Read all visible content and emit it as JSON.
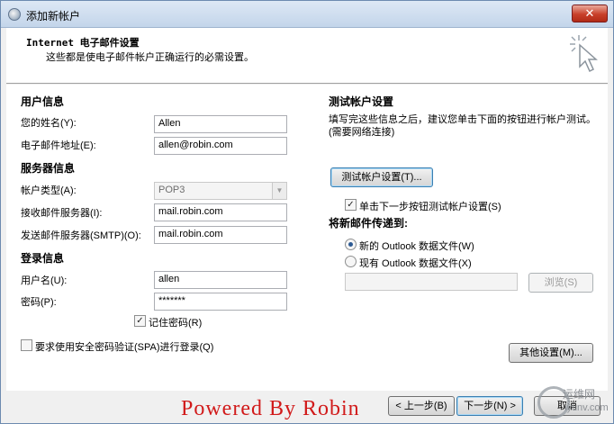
{
  "window": {
    "title": "添加新帐户",
    "close_glyph": "✕"
  },
  "header": {
    "title": "Internet 电子邮件设置",
    "subtitle": "这些都是使电子邮件帐户正确运行的必需设置。",
    "icon": "cursor-click-icon"
  },
  "user_info": {
    "heading": "用户信息",
    "name_label": "您的姓名(Y):",
    "name_value": "Allen",
    "email_label": "电子邮件地址(E):",
    "email_value": "allen@robin.com"
  },
  "server_info": {
    "heading": "服务器信息",
    "account_type_label": "帐户类型(A):",
    "account_type_value": "POP3",
    "incoming_label": "接收邮件服务器(I):",
    "incoming_value": "mail.robin.com",
    "outgoing_label": "发送邮件服务器(SMTP)(O):",
    "outgoing_value": "mail.robin.com"
  },
  "login_info": {
    "heading": "登录信息",
    "username_label": "用户名(U):",
    "username_value": "allen",
    "password_label": "密码(P):",
    "password_value": "*******",
    "remember_label": "记住密码(R)",
    "remember_checked": true,
    "spa_label": "要求使用安全密码验证(SPA)进行登录(Q)",
    "spa_checked": false
  },
  "test_settings": {
    "heading": "测试帐户设置",
    "description": "填写完这些信息之后，建议您单击下面的按钮进行帐户测试。(需要网络连接)",
    "test_button": "测试帐户设置(T)...",
    "auto_test_label": "单击下一步按钮测试帐户设置(S)",
    "auto_test_checked": true
  },
  "deliver_to": {
    "heading": "将新邮件传递到:",
    "new_file_label": "新的 Outlook 数据文件(W)",
    "existing_file_label": "现有 Outlook 数据文件(X)",
    "selected": "new",
    "path_value": "",
    "browse_button": "浏览(S)"
  },
  "more_settings_button": "其他设置(M)...",
  "footer": {
    "back_button": "< 上一步(B)",
    "next_button": "下一步(N) >",
    "cancel_button": "取消"
  },
  "watermark": "Powered By Robin",
  "site_logo": {
    "name": "运维网",
    "url": "iyunv.com"
  }
}
